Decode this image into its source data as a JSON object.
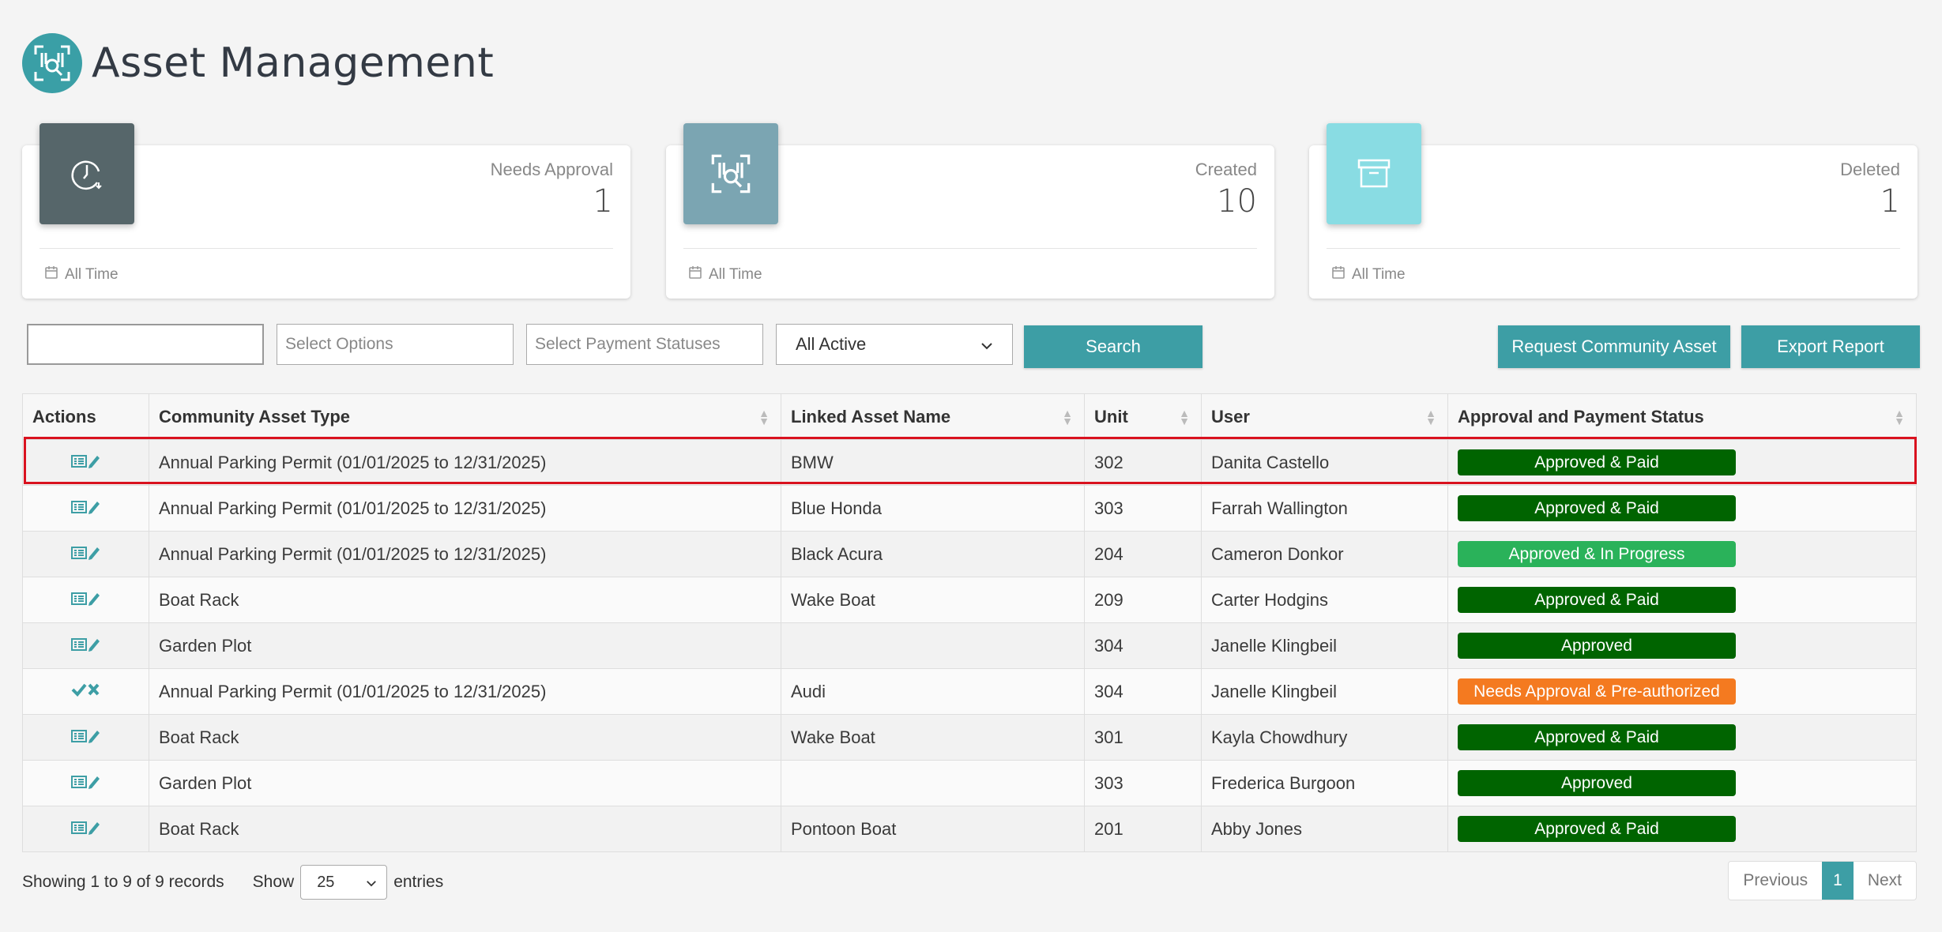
{
  "header": {
    "title": "Asset Management",
    "logo_icon": "barcode-search-icon"
  },
  "stats": [
    {
      "label": "Needs Approval",
      "value": "1",
      "footer": "All Time",
      "icon": "clock-icon",
      "color": "#56666a"
    },
    {
      "label": "Created",
      "value": "10",
      "footer": "All Time",
      "icon": "barcode-search-icon",
      "color": "#7ba5b2"
    },
    {
      "label": "Deleted",
      "value": "1",
      "footer": "All Time",
      "icon": "archive-box-icon",
      "color": "#89dce3"
    }
  ],
  "filters": {
    "search_value": "",
    "options_placeholder": "Select Options",
    "payment_placeholder": "Select Payment Statuses",
    "status_select": "All Active",
    "search_button": "Search",
    "request_button": "Request Community Asset",
    "export_button": "Export Report"
  },
  "table": {
    "headers": [
      "Actions",
      "Community Asset Type",
      "Linked Asset Name",
      "Unit",
      "User",
      "Approval and Payment Status"
    ],
    "rows": [
      {
        "action": "view-edit",
        "type": "Annual Parking Permit (01/01/2025 to 12/31/2025)",
        "asset": "BMW",
        "unit": "302",
        "user": "Danita Castello",
        "status": "Approved & Paid",
        "status_color": "#006400"
      },
      {
        "action": "view-edit",
        "type": "Annual Parking Permit (01/01/2025 to 12/31/2025)",
        "asset": "Blue Honda",
        "unit": "303",
        "user": "Farrah Wallington",
        "status": "Approved & Paid",
        "status_color": "#006400"
      },
      {
        "action": "view-edit",
        "type": "Annual Parking Permit (01/01/2025 to 12/31/2025)",
        "asset": "Black Acura",
        "unit": "204",
        "user": "Cameron Donkor",
        "status": "Approved & In Progress",
        "status_color": "#2ab25a"
      },
      {
        "action": "view-edit",
        "type": "Boat Rack",
        "asset": "Wake Boat",
        "unit": "209",
        "user": "Carter Hodgins",
        "status": "Approved & Paid",
        "status_color": "#006400"
      },
      {
        "action": "view-edit",
        "type": "Garden Plot",
        "asset": "",
        "unit": "304",
        "user": "Janelle Klingbeil",
        "status": "Approved",
        "status_color": "#006400"
      },
      {
        "action": "approve-reject",
        "type": "Annual Parking Permit (01/01/2025 to 12/31/2025)",
        "asset": "Audi",
        "unit": "304",
        "user": "Janelle Klingbeil",
        "status": "Needs Approval & Pre-authorized",
        "status_color": "#f47a20"
      },
      {
        "action": "view-edit",
        "type": "Boat Rack",
        "asset": "Wake Boat",
        "unit": "301",
        "user": "Kayla Chowdhury",
        "status": "Approved & Paid",
        "status_color": "#006400"
      },
      {
        "action": "view-edit",
        "type": "Garden Plot",
        "asset": "",
        "unit": "303",
        "user": "Frederica Burgoon",
        "status": "Approved",
        "status_color": "#006400"
      },
      {
        "action": "view-edit",
        "type": "Boat Rack",
        "asset": "Pontoon Boat",
        "unit": "201",
        "user": "Abby Jones",
        "status": "Approved & Paid",
        "status_color": "#006400"
      }
    ]
  },
  "footer": {
    "showing": "Showing 1 to 9 of 9 records",
    "show_label": "Show",
    "page_size": "25",
    "entries_label": "entries",
    "prev": "Previous",
    "page": "1",
    "next": "Next"
  },
  "colors": {
    "accent": "#3d9ea5",
    "highlight": "#d9121f"
  }
}
